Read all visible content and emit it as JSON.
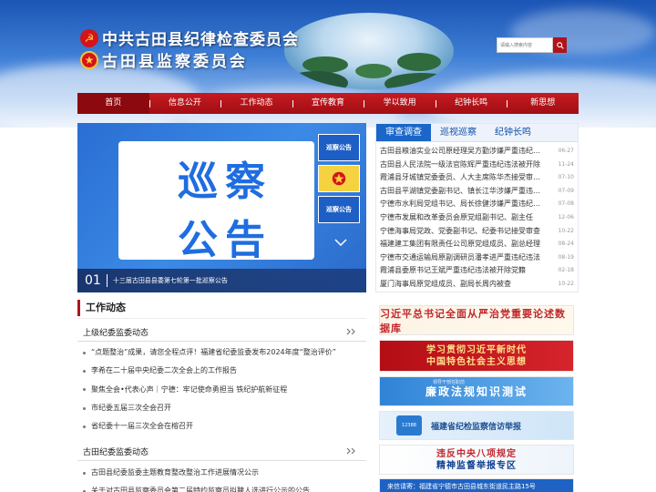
{
  "header": {
    "title_line1": "中共古田县纪律检查委员会",
    "title_line2": "古田县监察委员会",
    "search_placeholder": "请输入搜索内容"
  },
  "nav": [
    {
      "label": "首页",
      "active": true
    },
    {
      "label": "信息公开"
    },
    {
      "label": "工作动态"
    },
    {
      "label": "宣传教育"
    },
    {
      "label": "学以致用"
    },
    {
      "label": "纪钟长鸣"
    },
    {
      "label": "新思想"
    }
  ],
  "banner": {
    "big_line1": "巡察",
    "big_line2": "公告",
    "thumbs": [
      "巡察公告",
      "",
      "巡察公告"
    ],
    "caption_index": "01",
    "caption_text": "十三届古田县县委第七轮第一批巡察公告"
  },
  "news": {
    "tabs": [
      "审查调查",
      "巡视巡察",
      "纪钟长鸣"
    ],
    "items": [
      {
        "title": "古田县粮油实业公司原经理吴方勤涉嫌严重违纪违法",
        "date": "06-27"
      },
      {
        "title": "古田县人民法院一级法官陈辉严重违纪违法被开除",
        "date": "11-24"
      },
      {
        "title": "霞浦县牙城镇党委委员、人大主席陈华杰接受审查调查",
        "date": "07-10"
      },
      {
        "title": "古田县平湖镇党委副书记、镇长江华涉嫌严重违纪违法",
        "date": "07-09"
      },
      {
        "title": "宁德市水利局党组书记、局长徐健涉嫌严重违纪违法",
        "date": "07-08"
      },
      {
        "title": "宁德市发展和改革委员会原党组副书记、副主任",
        "date": "12-06"
      },
      {
        "title": "宁德海事局党政、党委副书记、纪委书记接受审查",
        "date": "10-22"
      },
      {
        "title": "福建建工集团有限责任公司原党组成员、副总经理",
        "date": "08-24"
      },
      {
        "title": "宁德市交通运输局原副调研员潘孝进严重违纪违法",
        "date": "08-19"
      },
      {
        "title": "霞浦县委原书记王斌严重违纪违法被开除党籍",
        "date": "02-18"
      },
      {
        "title": "厦门海事局原党组成员、副局长周内被查",
        "date": "10-22"
      }
    ]
  },
  "work": {
    "section_title": "工作动态",
    "group1_title": "上级纪委监委动态",
    "group1_items": [
      "“点题整治”成果，请您全程点评！福建省纪委监委发布2024年度“整治评价”",
      "李希在二十届中央纪委二次全会上的工作报告",
      "聚焦全会•代表心声｜宁德：牢记使命勇担当 铁纪护航新征程",
      "市纪委五届三次全会召开",
      "省纪委十一届三次全会在榕召开"
    ],
    "group2_title": "古田纪委监委动态",
    "group2_items": [
      "古田县纪委监委主题教育整改整治工作进展情况公示",
      "关于对古田县监察委员会第二届特约监察员拟聘人选进行公示的公告"
    ]
  },
  "side_ads": {
    "ad1": "习近平总书记全面从严治党重要论述数据库",
    "ad2_line1": "学习贯彻习近平新时代",
    "ad2_line2": "中国特色社会主义思想",
    "ad3": "廉政法规知识测试",
    "ad3_small": "领导干部任职前",
    "ad4_phone": "12388",
    "ad4": "福建省纪检监察信访举报",
    "ad5_line1": "违反中央八项规定",
    "ad5_line2": "精神监督举报专区",
    "ad6": "来信请寄：福建省宁德市古田县城东街道民主路15号"
  }
}
